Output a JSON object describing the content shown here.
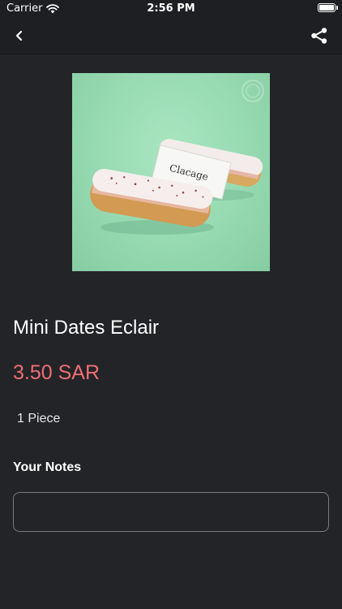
{
  "status_bar": {
    "carrier": "Carrier",
    "time": "2:56 PM",
    "wifi_icon": "wifi-icon",
    "battery_icon": "battery-icon"
  },
  "nav_bar": {
    "back_icon": "chevron-left-icon",
    "share_icon": "share-icon"
  },
  "product": {
    "image_icon": "eclair-photo",
    "image_card_text": "Clacage",
    "title": "Mini Dates Eclair",
    "price": "3.50 SAR",
    "quantity": "1 Piece"
  },
  "notes": {
    "label": "Your Notes",
    "value": "",
    "placeholder": ""
  },
  "colors": {
    "background": "#232428",
    "bar_background": "#1e1f22",
    "price": "#ee6e73",
    "image_background": "#9bdcb5",
    "field_border": "#7a7b80"
  }
}
